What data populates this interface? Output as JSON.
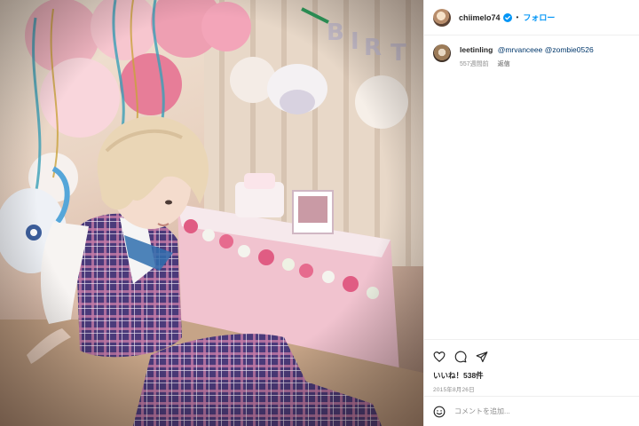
{
  "post": {
    "username": "chiimelo74",
    "follow_label": "フォロー",
    "separator": "•"
  },
  "comment": {
    "username": "leetinling",
    "mention_1": "@mrvanceee",
    "mention_2": "@zombie0526",
    "age": "557週間前",
    "reply_label": "返信"
  },
  "footer": {
    "likes_label": "いいね！538件",
    "date": "2015年8月26日",
    "add_comment_placeholder": "コメントを追加..."
  },
  "icons": {
    "verified": "verified-badge-icon",
    "like": "heart-icon",
    "comment": "comment-bubble-icon",
    "share": "paper-plane-icon",
    "emoji": "smiley-icon"
  },
  "colors": {
    "follow": "#0095f6",
    "verified": "#0095f6",
    "mention": "#00376b",
    "muted": "#8e8e8e"
  }
}
